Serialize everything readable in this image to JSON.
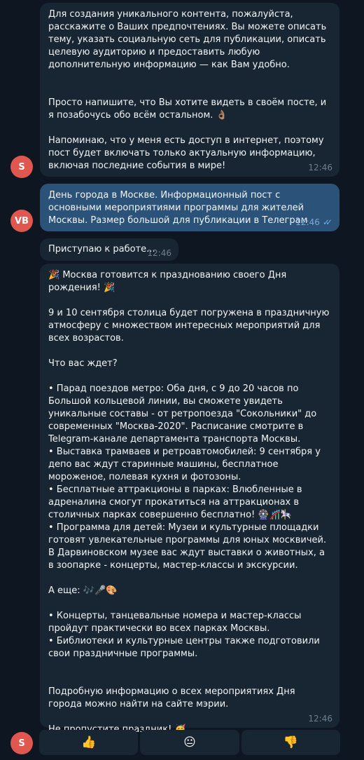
{
  "messages": [
    {
      "avatar": "S",
      "text": "Для создания уникального контента, пожалуйста, расскажите о Ваших предпочтениях. Вы можете описать тему, указать социальную сеть для публикации, описать целевую аудиторию и предоставить любую дополнительную информацию — как Вам удобно.\n\n\nПросто напишите, что Вы хотите видеть в своём посте, и я позабочусь обо всём остальном. 👌🏽\n\nНапоминаю, что у меня есть доступ в интернет, поэтому пост будет включать только актуальную информацию, включая последние события в мире!",
      "time": "12:46"
    },
    {
      "avatar": "VB",
      "text": "День города в Москве. Информационный пост с основными мероприятиями программы для жителей Москвы. Размер большой для публикации в Телеграм",
      "time": "12:46"
    },
    {
      "text": "Приступаю к работе...",
      "time": "12:46"
    },
    {
      "avatar": "S",
      "text": "🎉 Москва готовится к празднованию своего Дня рождения! 🎉\n\n9 и 10 сентября столица будет погружена в праздничную атмосферу с множеством интересных мероприятий для всех возрастов.\n\nЧто вас ждет?\n\n• Парад поездов метро: Оба дня, с 9 до 20 часов по Большой кольцевой линии, вы сможете увидеть уникальные составы - от ретропоезда \"Сокольники\" до современных \"Москва-2020\". Расписание смотрите в Telegram-канале департамента транспорта Москвы.\n• Выставка трамваев и ретроавтомобилей: 9 сентября у депо вас ждут старинные машины, бесплатное мороженое, полевая кухня и фотозоны.\n• Бесплатные аттракционы в парках:  Влюбленные в адреналина смогут прокатиться на аттракционах в столичных парках совершенно бесплатно! 🎡🎢🎠\n• Программа для детей: Музеи и культурные площадки готовят увлекательные программы для юных москвичей. В Дарвиновском музее вас ждут выставки о животных, а в зоопарке - концерты, мастер-классы и экскурсии.\n\nА еще: 🎶🎤🎨\n\n• Концерты, танцевальные номера и мастер-классы пройдут практически во всех парках Москвы.\n• Библиотеки и культурные центры также подготовили свои праздничные программы.\n\n\nПодробную информацию о всех мероприятиях Дня города можно найти на сайте мэрии.\n\nНе пропустите праздник! 🥳",
      "time": "12:46"
    }
  ],
  "reactions": [
    "👍",
    "😐",
    "👎"
  ],
  "colors": {
    "background": "#0e1621",
    "incoming_bubble": "#182533",
    "outgoing_bubble": "#2b5278",
    "avatar": "#e0574f"
  }
}
